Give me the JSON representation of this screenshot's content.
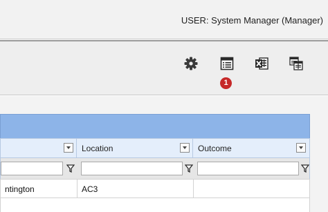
{
  "header": {
    "user_label": "USER: System Manager (Manager)"
  },
  "toolbar": {
    "icons": [
      "gear-icon",
      "grid-view-icon",
      "excel-export-icon",
      "column-chooser-icon"
    ],
    "badge_count": "1",
    "badge_color": "#c62828"
  },
  "grid": {
    "header_color": "#8db4e8",
    "columns": [
      {
        "label": ""
      },
      {
        "label": "Location"
      },
      {
        "label": "Outcome"
      }
    ],
    "filters": [
      {
        "value": "",
        "placeholder": ""
      },
      {
        "value": "",
        "placeholder": ""
      },
      {
        "value": "",
        "placeholder": ""
      }
    ],
    "rows": [
      [
        "ntington",
        "AC3",
        ""
      ]
    ]
  }
}
